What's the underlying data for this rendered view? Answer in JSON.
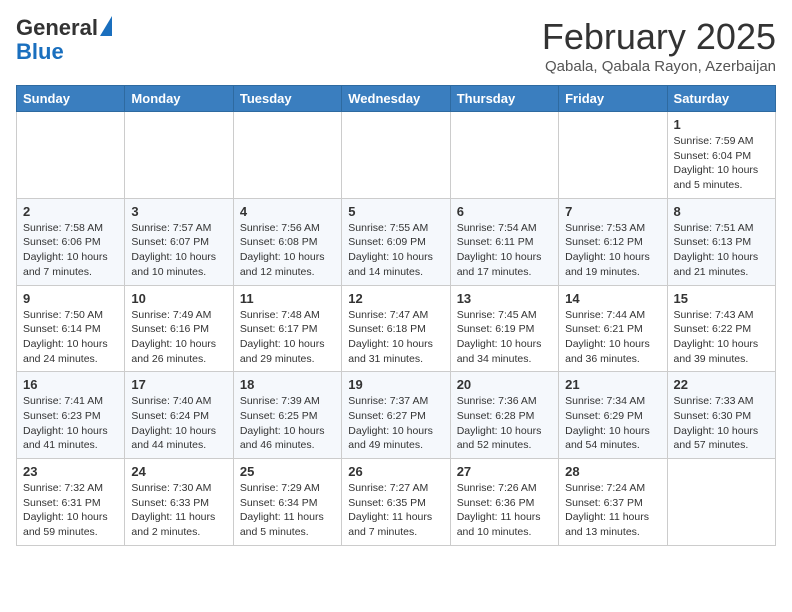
{
  "logo": {
    "general": "General",
    "blue": "Blue"
  },
  "header": {
    "month": "February 2025",
    "location": "Qabala, Qabala Rayon, Azerbaijan"
  },
  "days_of_week": [
    "Sunday",
    "Monday",
    "Tuesday",
    "Wednesday",
    "Thursday",
    "Friday",
    "Saturday"
  ],
  "weeks": [
    [
      {
        "day": "",
        "info": ""
      },
      {
        "day": "",
        "info": ""
      },
      {
        "day": "",
        "info": ""
      },
      {
        "day": "",
        "info": ""
      },
      {
        "day": "",
        "info": ""
      },
      {
        "day": "",
        "info": ""
      },
      {
        "day": "1",
        "info": "Sunrise: 7:59 AM\nSunset: 6:04 PM\nDaylight: 10 hours and 5 minutes."
      }
    ],
    [
      {
        "day": "2",
        "info": "Sunrise: 7:58 AM\nSunset: 6:06 PM\nDaylight: 10 hours and 7 minutes."
      },
      {
        "day": "3",
        "info": "Sunrise: 7:57 AM\nSunset: 6:07 PM\nDaylight: 10 hours and 10 minutes."
      },
      {
        "day": "4",
        "info": "Sunrise: 7:56 AM\nSunset: 6:08 PM\nDaylight: 10 hours and 12 minutes."
      },
      {
        "day": "5",
        "info": "Sunrise: 7:55 AM\nSunset: 6:09 PM\nDaylight: 10 hours and 14 minutes."
      },
      {
        "day": "6",
        "info": "Sunrise: 7:54 AM\nSunset: 6:11 PM\nDaylight: 10 hours and 17 minutes."
      },
      {
        "day": "7",
        "info": "Sunrise: 7:53 AM\nSunset: 6:12 PM\nDaylight: 10 hours and 19 minutes."
      },
      {
        "day": "8",
        "info": "Sunrise: 7:51 AM\nSunset: 6:13 PM\nDaylight: 10 hours and 21 minutes."
      }
    ],
    [
      {
        "day": "9",
        "info": "Sunrise: 7:50 AM\nSunset: 6:14 PM\nDaylight: 10 hours and 24 minutes."
      },
      {
        "day": "10",
        "info": "Sunrise: 7:49 AM\nSunset: 6:16 PM\nDaylight: 10 hours and 26 minutes."
      },
      {
        "day": "11",
        "info": "Sunrise: 7:48 AM\nSunset: 6:17 PM\nDaylight: 10 hours and 29 minutes."
      },
      {
        "day": "12",
        "info": "Sunrise: 7:47 AM\nSunset: 6:18 PM\nDaylight: 10 hours and 31 minutes."
      },
      {
        "day": "13",
        "info": "Sunrise: 7:45 AM\nSunset: 6:19 PM\nDaylight: 10 hours and 34 minutes."
      },
      {
        "day": "14",
        "info": "Sunrise: 7:44 AM\nSunset: 6:21 PM\nDaylight: 10 hours and 36 minutes."
      },
      {
        "day": "15",
        "info": "Sunrise: 7:43 AM\nSunset: 6:22 PM\nDaylight: 10 hours and 39 minutes."
      }
    ],
    [
      {
        "day": "16",
        "info": "Sunrise: 7:41 AM\nSunset: 6:23 PM\nDaylight: 10 hours and 41 minutes."
      },
      {
        "day": "17",
        "info": "Sunrise: 7:40 AM\nSunset: 6:24 PM\nDaylight: 10 hours and 44 minutes."
      },
      {
        "day": "18",
        "info": "Sunrise: 7:39 AM\nSunset: 6:25 PM\nDaylight: 10 hours and 46 minutes."
      },
      {
        "day": "19",
        "info": "Sunrise: 7:37 AM\nSunset: 6:27 PM\nDaylight: 10 hours and 49 minutes."
      },
      {
        "day": "20",
        "info": "Sunrise: 7:36 AM\nSunset: 6:28 PM\nDaylight: 10 hours and 52 minutes."
      },
      {
        "day": "21",
        "info": "Sunrise: 7:34 AM\nSunset: 6:29 PM\nDaylight: 10 hours and 54 minutes."
      },
      {
        "day": "22",
        "info": "Sunrise: 7:33 AM\nSunset: 6:30 PM\nDaylight: 10 hours and 57 minutes."
      }
    ],
    [
      {
        "day": "23",
        "info": "Sunrise: 7:32 AM\nSunset: 6:31 PM\nDaylight: 10 hours and 59 minutes."
      },
      {
        "day": "24",
        "info": "Sunrise: 7:30 AM\nSunset: 6:33 PM\nDaylight: 11 hours and 2 minutes."
      },
      {
        "day": "25",
        "info": "Sunrise: 7:29 AM\nSunset: 6:34 PM\nDaylight: 11 hours and 5 minutes."
      },
      {
        "day": "26",
        "info": "Sunrise: 7:27 AM\nSunset: 6:35 PM\nDaylight: 11 hours and 7 minutes."
      },
      {
        "day": "27",
        "info": "Sunrise: 7:26 AM\nSunset: 6:36 PM\nDaylight: 11 hours and 10 minutes."
      },
      {
        "day": "28",
        "info": "Sunrise: 7:24 AM\nSunset: 6:37 PM\nDaylight: 11 hours and 13 minutes."
      },
      {
        "day": "",
        "info": ""
      }
    ]
  ]
}
